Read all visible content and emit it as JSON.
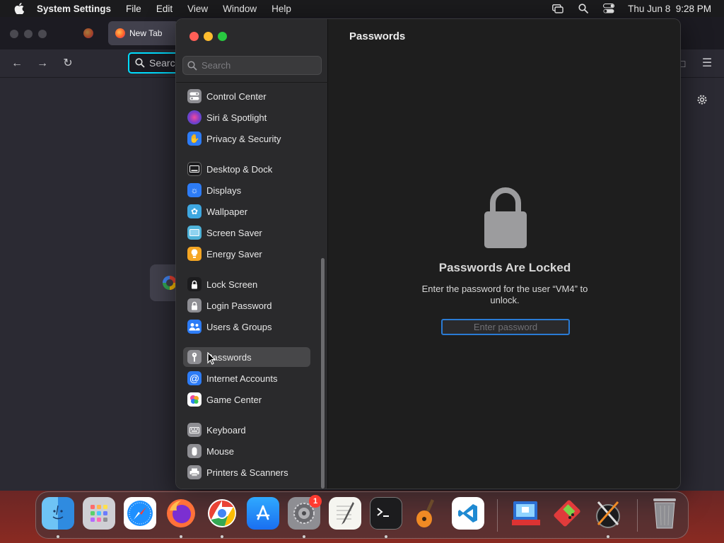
{
  "menubar": {
    "app_name": "System Settings",
    "menus": [
      "File",
      "Edit",
      "View",
      "Window",
      "Help"
    ],
    "datetime": "Thu Jun 8  9:28 PM"
  },
  "browser": {
    "tab_title": "New Tab",
    "url_placeholder": "Search"
  },
  "settings": {
    "search_placeholder": "Search",
    "sidebar_items": [
      {
        "label": "Control Center",
        "icon": "control-center-icon",
        "color": "#8e8e93"
      },
      {
        "label": "Siri & Spotlight",
        "icon": "siri-icon",
        "color": "#7a3cc8"
      },
      {
        "label": "Privacy & Security",
        "icon": "hand-icon",
        "color": "#2d7cf6"
      },
      {
        "label": "Desktop & Dock",
        "icon": "desktop-dock-icon",
        "color": "#3a3a3c"
      },
      {
        "label": "Displays",
        "icon": "displays-icon",
        "color": "#2d7cf6"
      },
      {
        "label": "Wallpaper",
        "icon": "wallpaper-icon",
        "color": "#3ea7e0"
      },
      {
        "label": "Screen Saver",
        "icon": "screen-saver-icon",
        "color": "#4fb3d9"
      },
      {
        "label": "Energy Saver",
        "icon": "energy-saver-icon",
        "color": "#f5a623"
      },
      {
        "label": "Lock Screen",
        "icon": "lock-screen-icon",
        "color": "#1c1c1e"
      },
      {
        "label": "Login Password",
        "icon": "login-password-icon",
        "color": "#8e8e93"
      },
      {
        "label": "Users & Groups",
        "icon": "users-groups-icon",
        "color": "#2d7cf6"
      },
      {
        "label": "Passwords",
        "icon": "key-icon",
        "color": "#8e8e93"
      },
      {
        "label": "Internet Accounts",
        "icon": "at-icon",
        "color": "#2d7cf6"
      },
      {
        "label": "Game Center",
        "icon": "game-center-icon",
        "color": "#e04a8a"
      },
      {
        "label": "Keyboard",
        "icon": "keyboard-icon",
        "color": "#8e8e93"
      },
      {
        "label": "Mouse",
        "icon": "mouse-icon",
        "color": "#8e8e93"
      },
      {
        "label": "Printers & Scanners",
        "icon": "printer-icon",
        "color": "#8e8e93"
      }
    ],
    "selected_item": "Passwords",
    "content": {
      "title": "Passwords",
      "locked_heading": "Passwords Are Locked",
      "locked_description": "Enter the password for the user “VM4” to unlock.",
      "password_placeholder": "Enter password"
    }
  },
  "dock": {
    "apps": [
      "Finder",
      "Launchpad",
      "Safari",
      "Firefox",
      "Chrome",
      "App Store",
      "System Settings",
      "TextEdit",
      "Terminal",
      "GarageBand",
      "Visual Studio Code",
      "Remote Desktop",
      "Gameboy Emulator",
      "Xcode",
      "Trash"
    ],
    "settings_badge": "1"
  }
}
